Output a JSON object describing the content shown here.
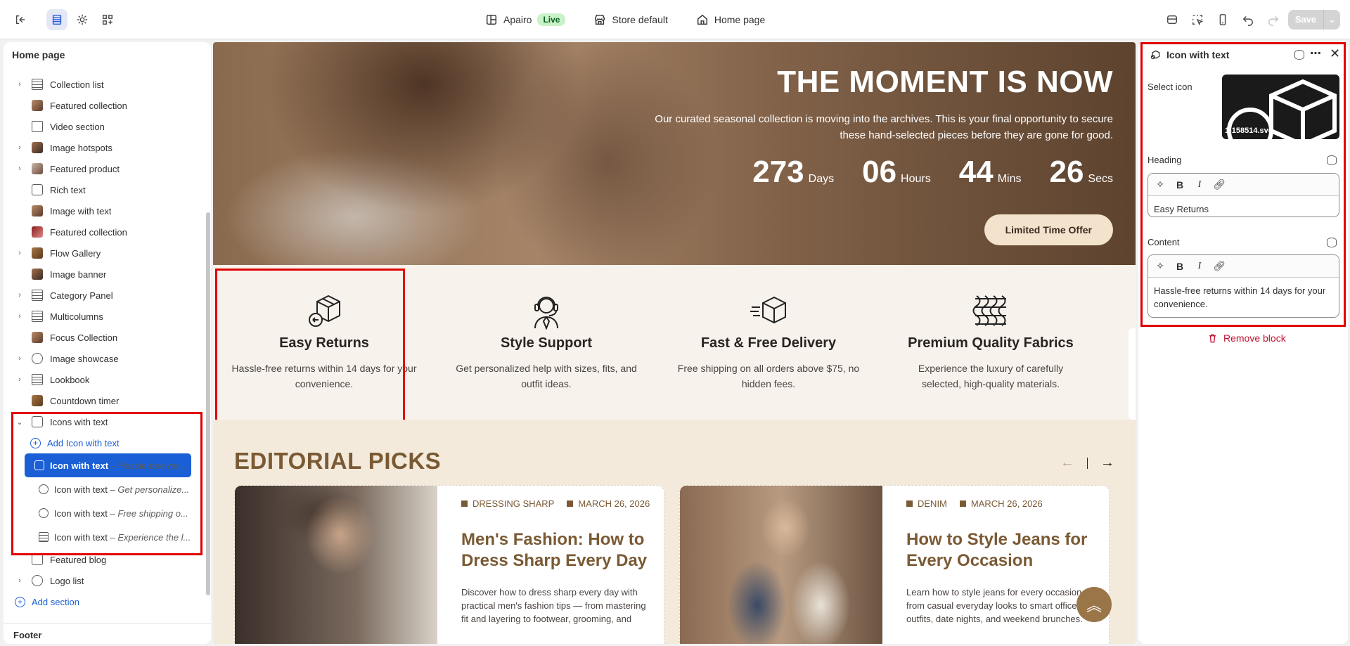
{
  "topbar": {
    "theme_name": "Apairo",
    "live_badge": "Live",
    "store": "Store default",
    "page": "Home page",
    "save_label": "Save"
  },
  "sidebar": {
    "title": "Home page",
    "sections": [
      {
        "label": "Collection list",
        "expandable": true,
        "icon": "list-icon"
      },
      {
        "label": "Featured collection",
        "expandable": false,
        "icon": "image-thumb"
      },
      {
        "label": "Video section",
        "expandable": false,
        "icon": "video-icon"
      },
      {
        "label": "Image hotspots",
        "expandable": true,
        "icon": "image-thumb"
      },
      {
        "label": "Featured product",
        "expandable": true,
        "icon": "image-thumb"
      },
      {
        "label": "Rich text",
        "expandable": false,
        "icon": "text-icon"
      },
      {
        "label": "Image with text",
        "expandable": false,
        "icon": "image-thumb"
      },
      {
        "label": "Featured collection",
        "expandable": false,
        "icon": "image-thumb"
      },
      {
        "label": "Flow Gallery",
        "expandable": true,
        "icon": "image-thumb"
      },
      {
        "label": "Image banner",
        "expandable": false,
        "icon": "image-thumb"
      },
      {
        "label": "Category Panel",
        "expandable": true,
        "icon": "list-icon"
      },
      {
        "label": "Multicolumns",
        "expandable": true,
        "icon": "list-icon"
      },
      {
        "label": "Focus Collection",
        "expandable": false,
        "icon": "image-thumb"
      },
      {
        "label": "Image showcase",
        "expandable": true,
        "icon": "image-icon"
      },
      {
        "label": "Lookbook",
        "expandable": true,
        "icon": "list-icon"
      },
      {
        "label": "Countdown timer",
        "expandable": false,
        "icon": "image-thumb"
      },
      {
        "label": "Icons with text",
        "expandable": true,
        "icon": "text-icon"
      }
    ],
    "add_block": "Add Icon with text",
    "blocks": [
      {
        "prefix": "Icon with text",
        "detail": " – Hassle-free ret..."
      },
      {
        "prefix": "Icon with text",
        "detail": " – Get personalize..."
      },
      {
        "prefix": "Icon with text",
        "detail": " – Free shipping o..."
      },
      {
        "prefix": "Icon with text",
        "detail": " – Experience the l..."
      }
    ],
    "after": [
      {
        "label": "Featured blog",
        "expandable": false
      },
      {
        "label": "Logo list",
        "expandable": true
      }
    ],
    "add_section": "Add section",
    "footer": "Footer"
  },
  "hero": {
    "title": "THE MOMENT IS NOW",
    "subtitle": "Our curated seasonal collection is moving into the archives. This is your final opportunity to secure these hand-selected pieces before they are gone for good.",
    "countdown": [
      {
        "num": "273",
        "unit": "Days"
      },
      {
        "num": "06",
        "unit": "Hours"
      },
      {
        "num": "44",
        "unit": "Mins"
      },
      {
        "num": "26",
        "unit": "Secs"
      }
    ],
    "button": "Limited Time Offer"
  },
  "features": [
    {
      "title": "Easy Returns",
      "text": "Hassle-free returns within 14 days for your convenience.",
      "icon": "box-return-icon"
    },
    {
      "title": "Style Support",
      "text": "Get personalized help with sizes, fits, and outfit ideas.",
      "icon": "support-agent-icon"
    },
    {
      "title": "Fast & Free Delivery",
      "text": "Free shipping on all orders above $75, no hidden fees.",
      "icon": "fast-box-icon"
    },
    {
      "title": "Premium Quality Fabrics",
      "text": "Experience the luxury of carefully selected, high-quality materials.",
      "icon": "fabric-icon"
    }
  ],
  "editorial": {
    "title": "EDITORIAL PICKS",
    "posts": [
      {
        "tag": "DRESSING SHARP",
        "date": "MARCH 26, 2026",
        "title": "Men's Fashion: How to Dress Sharp Every Day",
        "excerpt": "Discover how to dress sharp every day with practical men's fashion tips — from mastering fit and layering to footwear, grooming, and"
      },
      {
        "tag": "DENIM",
        "date": "MARCH 26, 2026",
        "title": "How to Style Jeans for Every Occasion",
        "excerpt": "Learn how to style jeans for every occasion from casual everyday looks to smart office outfits, date nights, and weekend brunches."
      }
    ]
  },
  "panel": {
    "title": "Icon with text",
    "select_icon_label": "Select icon",
    "icon_filename": "1-158514.svg",
    "heading_label": "Heading",
    "heading_value": "Easy Returns",
    "content_label": "Content",
    "content_value": "Hassle-free returns within 14 days for your convenience.",
    "remove_label": "Remove block"
  },
  "colors": {
    "accent": "#1a5fd6",
    "brand_brown": "#7a5a34",
    "highlight_red": "#e10000",
    "danger": "#c10f2e"
  }
}
